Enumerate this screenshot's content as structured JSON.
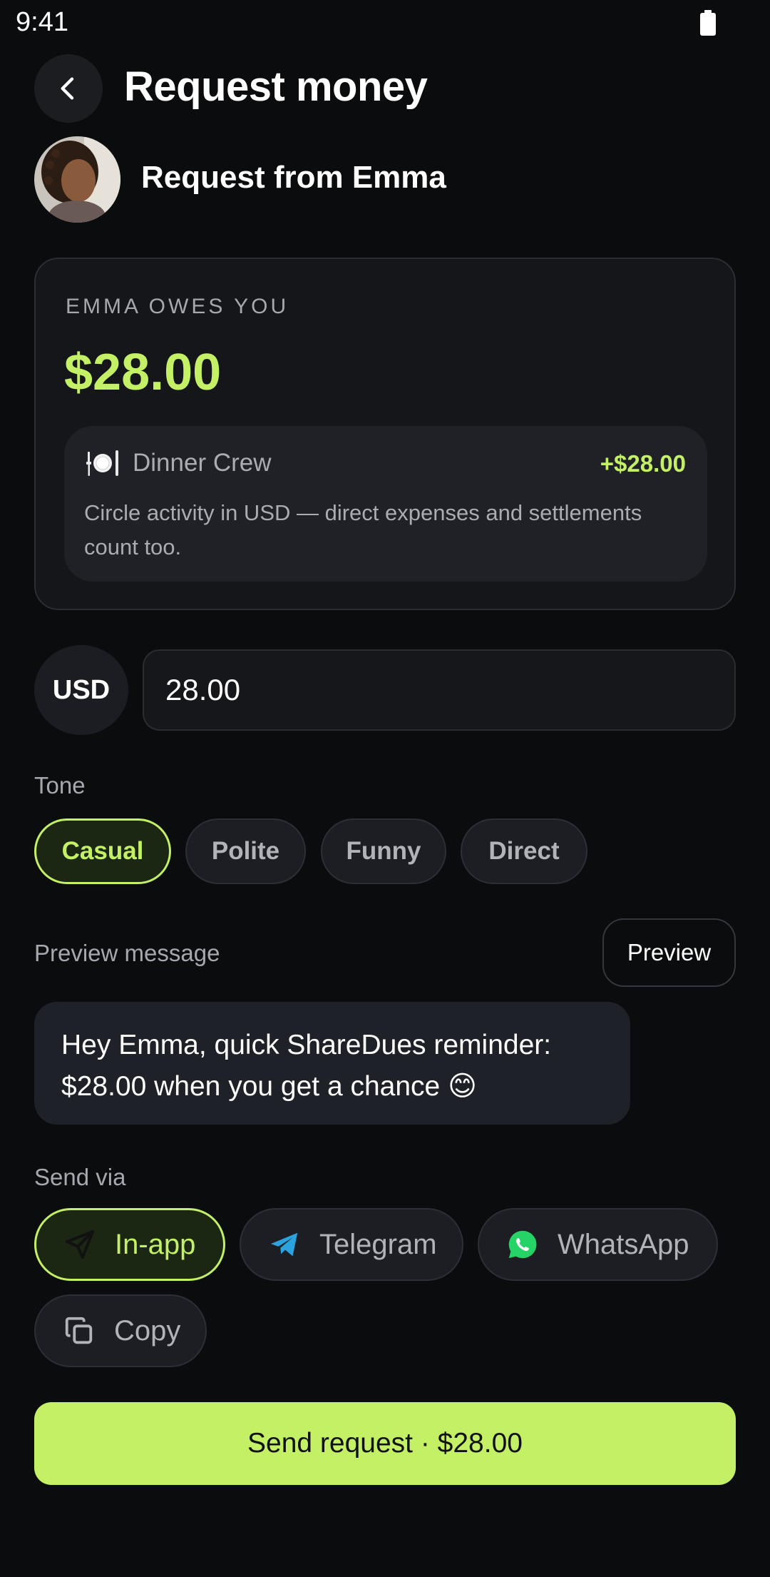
{
  "status": {
    "time": "9:41"
  },
  "header": {
    "title": "Request money"
  },
  "recipient": {
    "label": "Request from Emma"
  },
  "balance_card": {
    "label": "EMMA OWES YOU",
    "amount": "$28.00",
    "circle": {
      "icon": "plate-cutlery-icon",
      "name": "Dinner Crew",
      "amount": "+$28.00",
      "description": "Circle activity in USD — direct expenses and settlements count too."
    }
  },
  "amount_entry": {
    "currency": "USD",
    "value": "28.00"
  },
  "tone": {
    "label": "Tone",
    "options": [
      "Casual",
      "Polite",
      "Funny",
      "Direct"
    ],
    "selected": "Casual"
  },
  "preview": {
    "label": "Preview message",
    "button": "Preview",
    "message": "Hey Emma, quick ShareDues reminder: $28.00 when you get a chance 😊"
  },
  "send_via": {
    "label": "Send via",
    "options": [
      {
        "label": "In-app",
        "icon": "send-icon"
      },
      {
        "label": "Telegram",
        "icon": "telegram-icon"
      },
      {
        "label": "WhatsApp",
        "icon": "whatsapp-icon"
      },
      {
        "label": "Copy",
        "icon": "copy-icon"
      }
    ],
    "selected": "In-app"
  },
  "primary_action": {
    "label": "Send request · $28.00"
  },
  "colors": {
    "accent": "#c3f065",
    "background": "#0b0c0d",
    "card": "#14161a",
    "telegram": "#2aa3df",
    "whatsapp": "#25d366"
  }
}
